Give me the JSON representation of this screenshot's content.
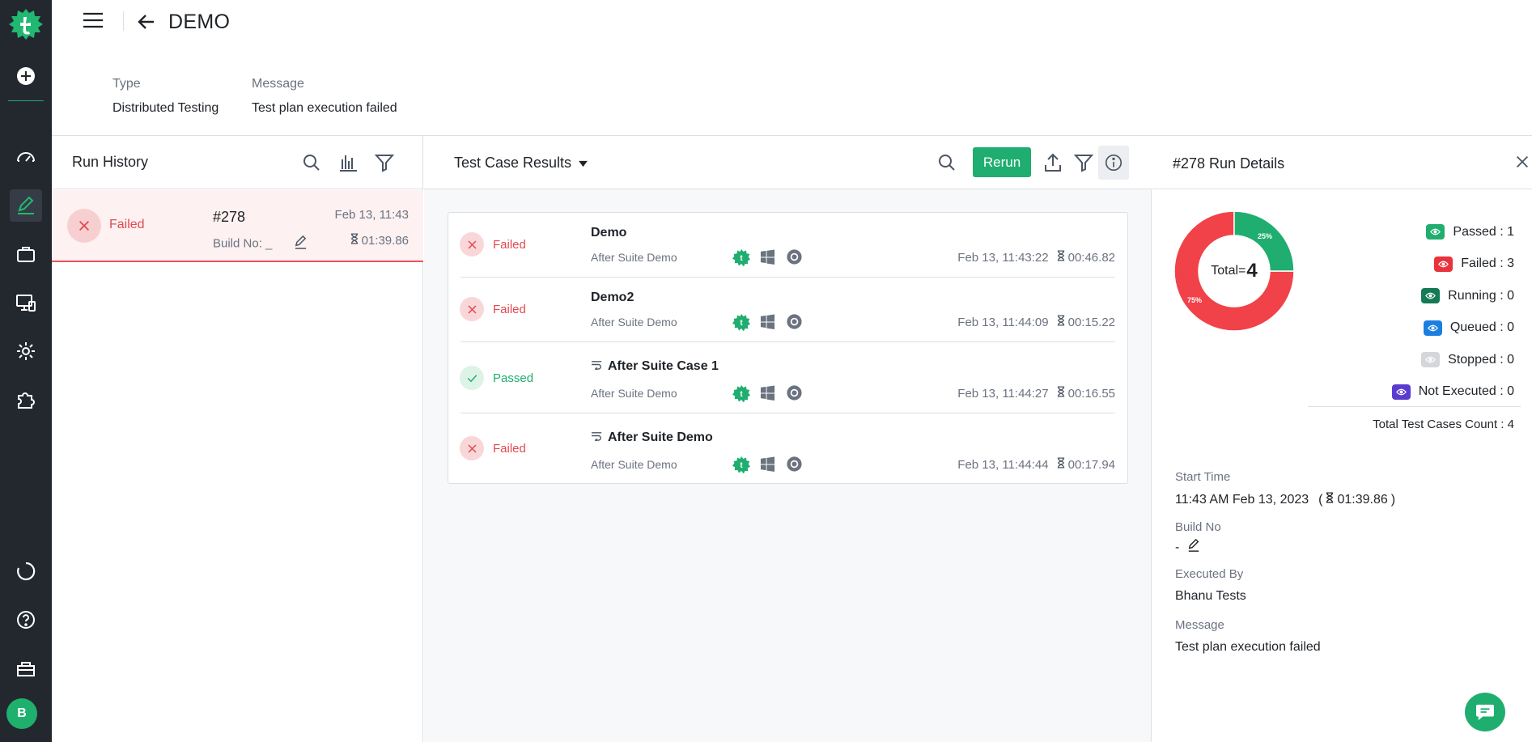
{
  "header": {
    "title": "DEMO"
  },
  "meta": {
    "type_label": "Type",
    "type_value": "Distributed Testing",
    "message_label": "Message",
    "message_value": "Test plan execution failed"
  },
  "rail": {
    "avatar_initial": "B"
  },
  "run_history": {
    "title": "Run History",
    "runs": [
      {
        "status": "Failed",
        "number": "#278",
        "build": "Build No: _",
        "date": "Feb 13, 11:43",
        "duration": "01:39.86"
      }
    ]
  },
  "results": {
    "title": "Test Case Results",
    "rerun_label": "Rerun",
    "rows": [
      {
        "status": "Failed",
        "name": "Demo",
        "suite": "After Suite Demo",
        "time": "Feb 13, 11:43:22",
        "duration": "00:46.82",
        "hook": false
      },
      {
        "status": "Failed",
        "name": "Demo2",
        "suite": "After Suite Demo",
        "time": "Feb 13, 11:44:09",
        "duration": "00:15.22",
        "hook": false
      },
      {
        "status": "Passed",
        "name": "After Suite Case 1",
        "suite": "After Suite Demo",
        "time": "Feb 13, 11:44:27",
        "duration": "00:16.55",
        "hook": true
      },
      {
        "status": "Failed",
        "name": "After Suite Demo",
        "suite": "After Suite Demo",
        "time": "Feb 13, 11:44:44",
        "duration": "00:17.94",
        "hook": true
      }
    ]
  },
  "details": {
    "title": "#278 Run Details",
    "total_label": "Total=",
    "total_value": "4",
    "passed_pct": "25%",
    "failed_pct": "75%",
    "donut": {
      "passed": 1,
      "failed": 3,
      "passed_color": "#1fae6f",
      "failed_color": "#f04248"
    },
    "legend": [
      {
        "label": "Passed : 1",
        "color": "#1fae6f"
      },
      {
        "label": "Failed : 3",
        "color": "#e8323c"
      },
      {
        "label": "Running : 0",
        "color": "#137a55"
      },
      {
        "label": "Queued : 0",
        "color": "#1a7fe0"
      },
      {
        "label": "Stopped : 0",
        "color": "#d4d6d9"
      },
      {
        "label": "Not Executed : 0",
        "color": "#5a3bd0"
      }
    ],
    "total_count": "Total Test Cases Count : 4",
    "start_time_label": "Start Time",
    "start_time_value": "11:43 AM Feb 13, 2023",
    "start_duration": "01:39.86",
    "build_label": "Build No",
    "build_value": "-",
    "executed_by_label": "Executed By",
    "executed_by_value": "Bhanu Tests",
    "message_label": "Message",
    "message_value": "Test plan execution failed"
  }
}
